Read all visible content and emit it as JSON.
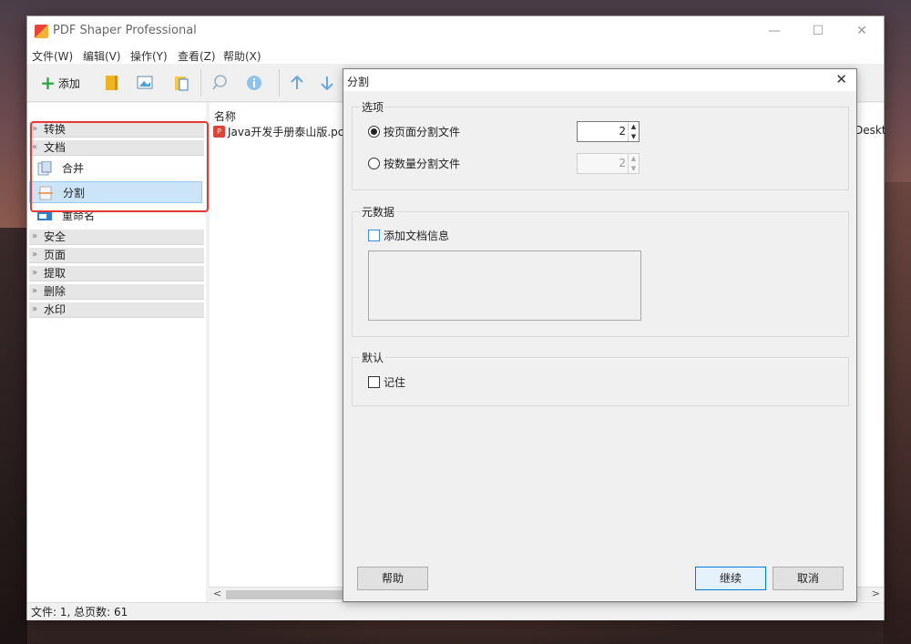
{
  "app": {
    "title": "PDF Shaper Professional",
    "window_controls": {
      "minimize": "—",
      "maximize": "☐",
      "close": "✕"
    }
  },
  "menu": [
    "文件(W)",
    "编辑(V)",
    "操作(Y)",
    "查看(Z)",
    "帮助(X)"
  ],
  "toolbar": {
    "add_label": "添加",
    "icons": [
      "folder-icon",
      "image-icon",
      "clipboard-icon",
      "search-icon",
      "info-icon",
      "arrow-up-icon",
      "arrow-down-icon"
    ]
  },
  "sidebar": {
    "categories": [
      {
        "label": "转换",
        "chevron": "»"
      },
      {
        "label": "文档",
        "chevron": "«"
      },
      {
        "label": "安全",
        "chevron": "»"
      },
      {
        "label": "页面",
        "chevron": "»"
      },
      {
        "label": "提取",
        "chevron": "»"
      },
      {
        "label": "删除",
        "chevron": "»"
      },
      {
        "label": "水印",
        "chevron": "»"
      }
    ],
    "document_items": [
      {
        "label": "合并",
        "selected": false
      },
      {
        "label": "分割",
        "selected": true
      },
      {
        "label": "重命名",
        "selected": false
      }
    ]
  },
  "file_list": {
    "column_name": "名称",
    "files": [
      {
        "name": "Java开发手册泰山版.pc",
        "path_fragment": "Deskt"
      }
    ]
  },
  "scroll": {
    "left": "<",
    "right": ">"
  },
  "status": "文件: 1, 总页数: 61",
  "dialog": {
    "title": "分割",
    "close": "✕",
    "options_group": "选项",
    "radio_by_pages": {
      "label": "按页面分割文件",
      "checked": true,
      "value": "2"
    },
    "radio_by_count": {
      "label": "按数量分割文件",
      "checked": false,
      "value": "2"
    },
    "metadata_group": "元数据",
    "add_doc_info": "添加文档信息",
    "default_group": "默认",
    "remember": "记住",
    "buttons": {
      "help": "帮助",
      "continue": "继续",
      "cancel": "取消"
    }
  },
  "colors": {
    "highlight_border": "#e53935",
    "selection": "#cce4f7",
    "primary_button_border": "#0078d7"
  }
}
